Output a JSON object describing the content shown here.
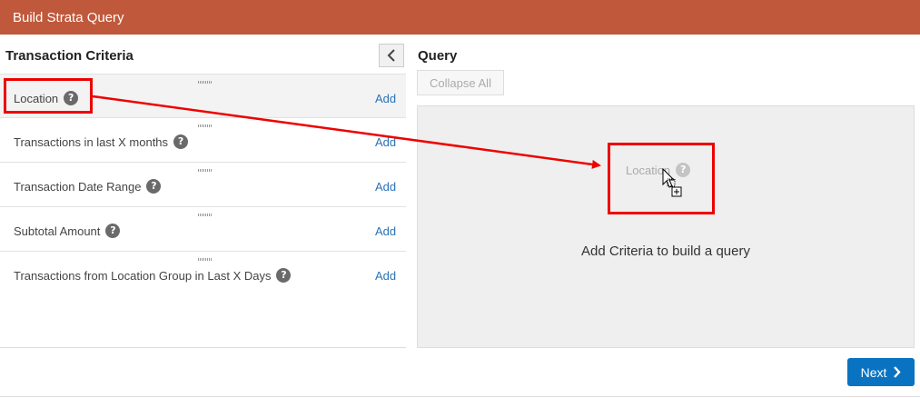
{
  "window": {
    "title": "Build Strata Query"
  },
  "left_panel": {
    "title": "Transaction Criteria",
    "items": [
      {
        "label": "Location",
        "add_label": "Add"
      },
      {
        "label": "Transactions in last X months",
        "add_label": "Add"
      },
      {
        "label": "Transaction Date Range",
        "add_label": "Add"
      },
      {
        "label": "Subtotal Amount",
        "add_label": "Add"
      },
      {
        "label": "Transactions from Location Group in Last X Days",
        "add_label": "Add"
      }
    ]
  },
  "query_panel": {
    "title": "Query",
    "collapse_all_label": "Collapse All",
    "dragged_item_label": "Location",
    "empty_message": "Add Criteria to build a query"
  },
  "footer": {
    "next_label": "Next"
  },
  "colors": {
    "header": "#c0583b",
    "primary_button": "#0a73c1",
    "link": "#2a72b5",
    "annotation": "#e00000"
  }
}
